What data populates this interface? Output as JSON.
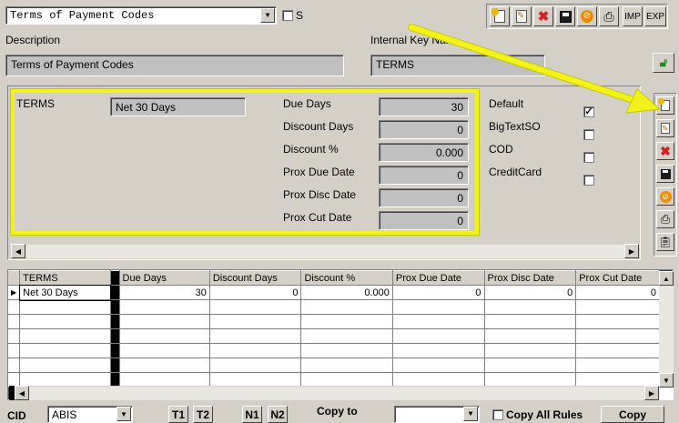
{
  "header": {
    "code_select": "Terms of Payment Codes",
    "s_label": "S",
    "description_label": "Description",
    "description_value": "Terms of Payment Codes",
    "internal_key_label": "Internal Key Nam",
    "internal_key_value": "TERMS"
  },
  "toolbar": {
    "buttons": [
      {
        "name": "new-icon",
        "glyph": "✎"
      },
      {
        "name": "edit-icon",
        "glyph": "✐"
      },
      {
        "name": "delete-icon",
        "glyph": "✖"
      },
      {
        "name": "save-icon",
        "glyph": "▣"
      },
      {
        "name": "cancel-icon",
        "glyph": "⊘"
      },
      {
        "name": "print-icon",
        "glyph": "⎙"
      }
    ],
    "imp_label": "IMP",
    "exp_label": "EXP"
  },
  "form": {
    "terms_label": "TERMS",
    "terms_value": "Net 30 Days",
    "fields": [
      {
        "label": "Due Days",
        "value": "30"
      },
      {
        "label": "Discount Days",
        "value": "0"
      },
      {
        "label": "Discount %",
        "value": "0.000"
      },
      {
        "label": "Prox Due Date",
        "value": "0"
      },
      {
        "label": "Prox Disc Date",
        "value": "0"
      },
      {
        "label": "Prox Cut Date",
        "value": "0"
      }
    ],
    "checks": [
      {
        "label": "Default",
        "checked": true
      },
      {
        "label": "BigTextSO",
        "checked": false
      },
      {
        "label": "COD",
        "checked": false
      },
      {
        "label": "CreditCard",
        "checked": false
      }
    ]
  },
  "grid": {
    "columns": [
      "TERMS",
      "Due Days",
      "Discount Days",
      "Discount %",
      "Prox Due Date",
      "Prox Disc Date",
      "Prox Cut Date"
    ],
    "rows": [
      [
        "Net 30 Days",
        "30",
        "0",
        "0.000",
        "0",
        "0",
        "0"
      ]
    ]
  },
  "footer": {
    "cid_label": "CID",
    "cid_value": "ABIS",
    "t1": "T1",
    "t2": "T2",
    "n1": "N1",
    "n2": "N2",
    "copy_to_label": "Copy to",
    "copy_to_value": "",
    "copy_all_rules_label": "Copy All Rules",
    "copy_button": "Copy"
  },
  "colors": {
    "highlight": "#f3f31a",
    "delete_red": "#d42020",
    "cancel_orange": "#f08a00",
    "lock_green": "#1a8a1a"
  }
}
